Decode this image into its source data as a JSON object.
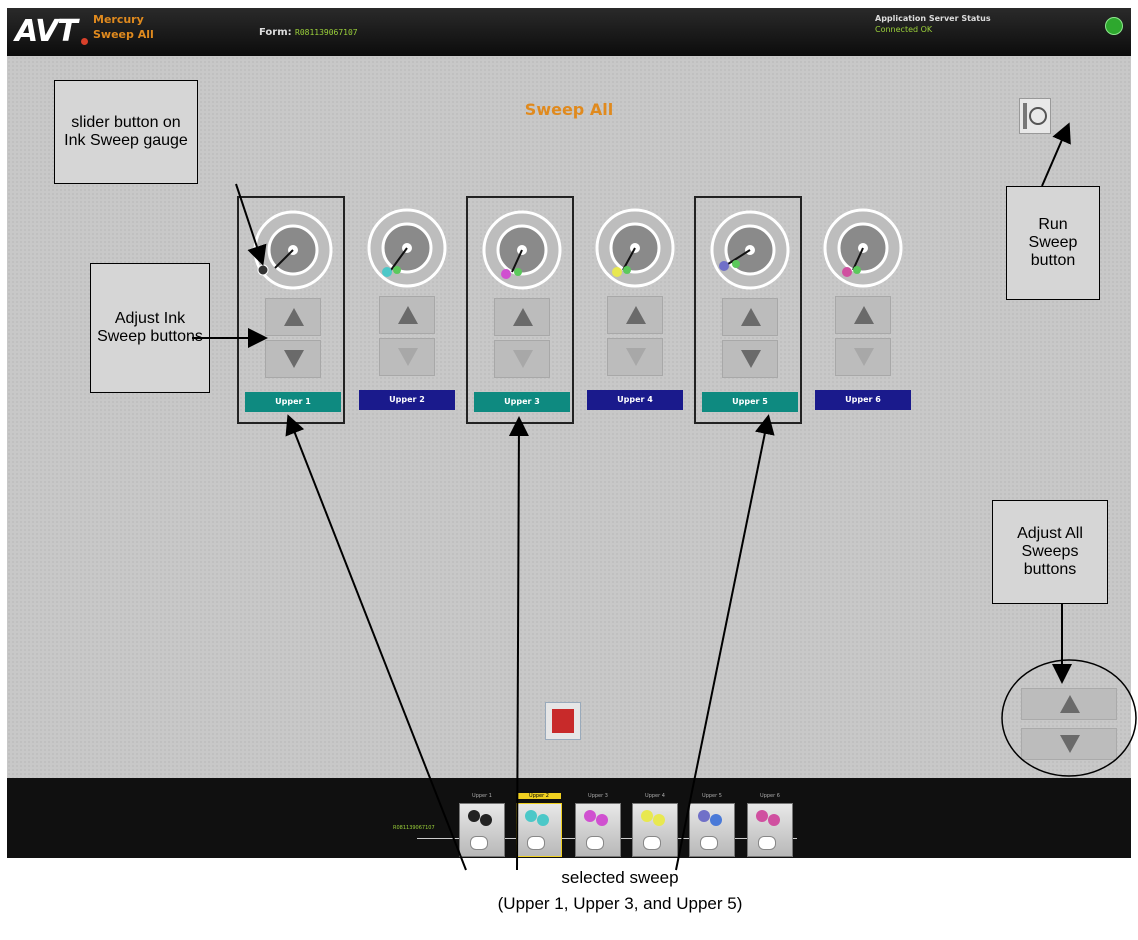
{
  "header": {
    "logo": "AVT",
    "app_name": "Mercury",
    "screen_name": "Sweep All",
    "form_label": "Form:",
    "form_value": "R081139067107",
    "server_status_label": "Application Server Status",
    "server_status_value": "Connected OK"
  },
  "main": {
    "title": "Sweep All",
    "sweeps": [
      {
        "label": "Upper 1",
        "selected": true
      },
      {
        "label": "Upper 2",
        "selected": false
      },
      {
        "label": "Upper 3",
        "selected": true
      },
      {
        "label": "Upper 4",
        "selected": false
      },
      {
        "label": "Upper 5",
        "selected": true
      },
      {
        "label": "Upper 6",
        "selected": false
      }
    ]
  },
  "bottom": {
    "form_id": "R081139067107",
    "units": [
      "Upper 1",
      "Upper 2",
      "Upper 3",
      "Upper 4",
      "Upper 5",
      "Upper 6"
    ]
  },
  "callouts": {
    "slider": "slider button on Ink Sweep gauge",
    "adjust": "Adjust Ink Sweep buttons",
    "run": "Run Sweep button",
    "adjust_all": "Adjust All Sweeps buttons",
    "caption_line1": "selected sweep",
    "caption_line2": "(Upper 1, Upper 3, and Upper 5)"
  },
  "colors": {
    "accent_orange": "#e08a1e",
    "tab_active": "#0e8a80",
    "tab_inactive": "#1a1a8c",
    "status_green": "#9bd13a"
  }
}
